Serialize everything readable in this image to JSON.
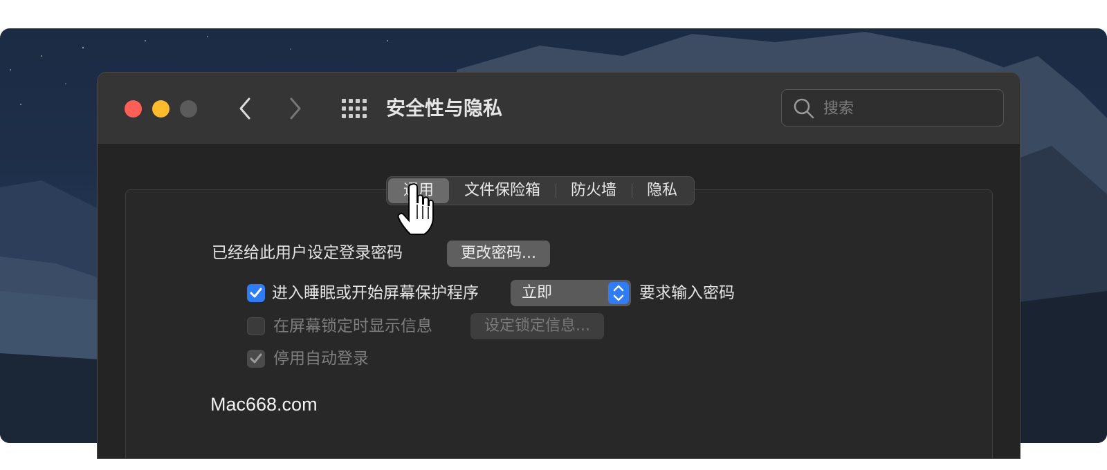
{
  "window": {
    "title": "安全性与隐私"
  },
  "search": {
    "placeholder": "搜索"
  },
  "tabs": [
    {
      "label": "通用",
      "active": true
    },
    {
      "label": "文件保险箱",
      "active": false
    },
    {
      "label": "防火墙",
      "active": false
    },
    {
      "label": "隐私",
      "active": false
    }
  ],
  "general": {
    "password_set_label": "已经给此用户设定登录密码",
    "change_password_button": "更改密码...",
    "require_password": {
      "checked": true,
      "label": "进入睡眠或开始屏幕保护程序",
      "delay_value": "立即",
      "suffix": "要求输入密码"
    },
    "show_message": {
      "checked": false,
      "label": "在屏幕锁定时显示信息",
      "button": "设定锁定信息..."
    },
    "disable_auto_login": {
      "checked": true,
      "label": "停用自动登录"
    }
  },
  "watermark": "Mac668.com",
  "colors": {
    "accent": "#2f7cf6",
    "close": "#fe5f57",
    "minimize": "#febb2d"
  },
  "icons": [
    "close-button",
    "minimize-button",
    "zoom-button",
    "back-chevron-icon",
    "forward-chevron-icon",
    "grid-icon",
    "search-icon",
    "checkmark-icon",
    "popup-arrows-icon",
    "hand-cursor-icon"
  ]
}
